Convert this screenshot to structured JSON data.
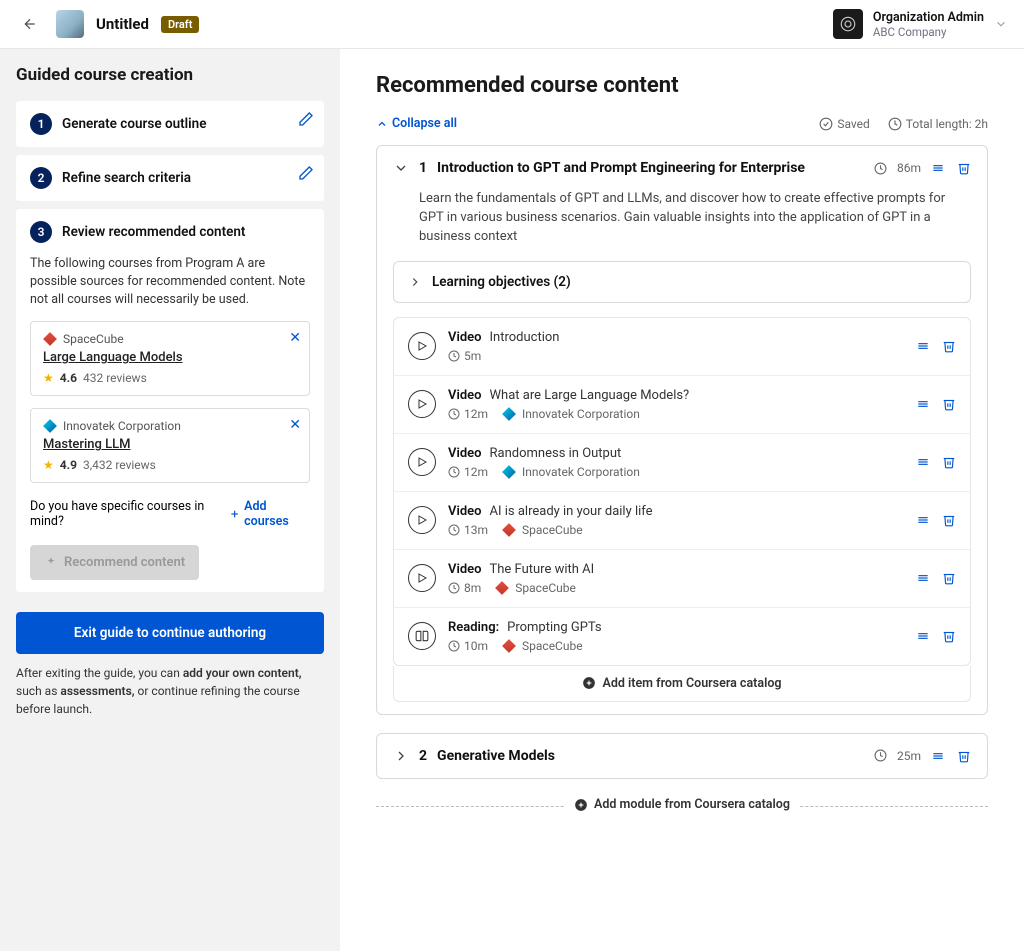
{
  "header": {
    "title": "Untitled",
    "badge": "Draft",
    "org_role": "Organization Admin",
    "org_name": "ABC Company"
  },
  "sidebar": {
    "heading": "Guided course creation",
    "steps": [
      {
        "num": "1",
        "label": "Generate course outline"
      },
      {
        "num": "2",
        "label": "Refine search criteria"
      },
      {
        "num": "3",
        "label": "Review recommended content"
      }
    ],
    "step3_text": "The following courses from Program A are possible sources for recommended content. Note not all courses will necessarily be used.",
    "sources": [
      {
        "provider": "SpaceCube",
        "provider_icon": "cube",
        "course": "Large Language Models",
        "rating": "4.6",
        "reviews": "432 reviews"
      },
      {
        "provider": "Innovatek Corporation",
        "provider_icon": "diam",
        "course": "Mastering LLM",
        "rating": "4.9",
        "reviews": "3,432 reviews"
      }
    ],
    "prompt": "Do you have specific courses in mind?",
    "add_courses": "Add courses",
    "recommend_btn": "Recommend content",
    "exit_btn": "Exit guide to continue authoring",
    "exit_note_1": "After exiting the guide, you can ",
    "exit_note_b1": "add your own content,",
    "exit_note_2": " such as ",
    "exit_note_b2": "assessments,",
    "exit_note_3": " or continue refining the course before launch."
  },
  "main": {
    "title": "Recommended course content",
    "collapse": "Collapse all",
    "saved": "Saved",
    "total": "Total length: 2h",
    "modules": [
      {
        "num": "1",
        "title": "Introduction to GPT and Prompt Engineering for Enterprise",
        "duration": "86m",
        "desc": "Learn the fundamentals of GPT and LLMs, and discover how to create effective prompts for GPT in various business scenarios. Gain valuable insights into the application of GPT in a business context",
        "lo": "Learning objectives (2)",
        "items": [
          {
            "type": "Video",
            "name": "Introduction",
            "dur": "5m",
            "provider": null,
            "icon": "play"
          },
          {
            "type": "Video",
            "name": "What are Large Language Models?",
            "dur": "12m",
            "provider": "Innovatek Corporation",
            "picon": "diam",
            "icon": "play"
          },
          {
            "type": "Video",
            "name": "Randomness in Output",
            "dur": "12m",
            "provider": "Innovatek Corporation",
            "picon": "diam",
            "icon": "play"
          },
          {
            "type": "Video",
            "name": "AI is already in your daily life",
            "dur": "13m",
            "provider": "SpaceCube",
            "picon": "cube",
            "icon": "play"
          },
          {
            "type": "Video",
            "name": "The Future with AI",
            "dur": "8m",
            "provider": "SpaceCube",
            "picon": "cube",
            "icon": "play"
          },
          {
            "type": "Reading:",
            "name": "Prompting GPTs",
            "dur": "10m",
            "provider": "SpaceCube",
            "picon": "cube",
            "icon": "book"
          }
        ],
        "add_item": "Add item from Coursera catalog"
      },
      {
        "num": "2",
        "title": "Generative Models",
        "duration": "25m"
      }
    ],
    "add_module": "Add module from Coursera catalog"
  }
}
